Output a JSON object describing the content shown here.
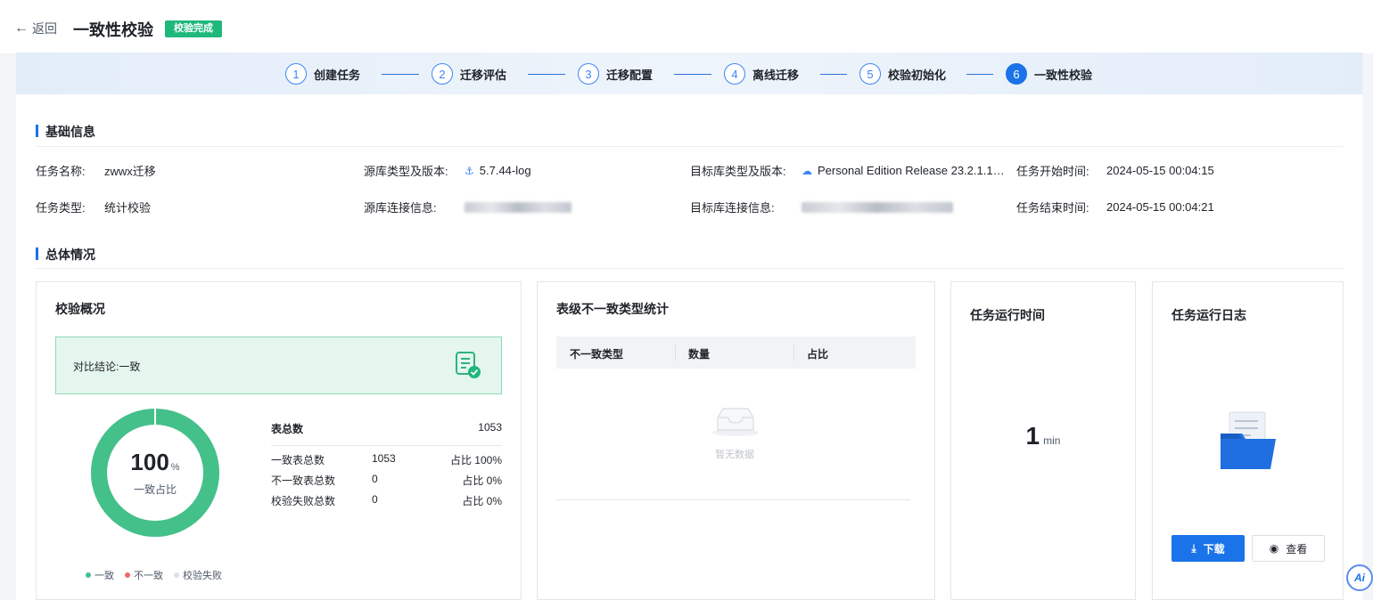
{
  "header": {
    "back_label": "返回",
    "title": "一致性校验",
    "status_badge": "校验完成"
  },
  "steps": [
    {
      "num": "1",
      "label": "创建任务"
    },
    {
      "num": "2",
      "label": "迁移评估"
    },
    {
      "num": "3",
      "label": "迁移配置"
    },
    {
      "num": "4",
      "label": "离线迁移"
    },
    {
      "num": "5",
      "label": "校验初始化"
    },
    {
      "num": "6",
      "label": "一致性校验",
      "active": true
    }
  ],
  "basic_info": {
    "section_title": "基础信息",
    "task_name_label": "任务名称:",
    "task_name": "zwwx迁移",
    "task_type_label": "任务类型:",
    "task_type": "统计校验",
    "source_type_label": "源库类型及版本:",
    "source_type": "5.7.44-log",
    "source_conn_label": "源库连接信息:",
    "target_type_label": "目标库类型及版本:",
    "target_type": "Personal Edition Release 23.2.1.1…",
    "target_conn_label": "目标库连接信息:",
    "start_time_label": "任务开始时间:",
    "start_time": "2024-05-15 00:04:15",
    "end_time_label": "任务结束时间:",
    "end_time": "2024-05-15 00:04:21"
  },
  "overview": {
    "section_title": "总体情况",
    "verify_card": {
      "title": "校验概况",
      "conclusion": "对比结论:一致",
      "consistent_percent": 100,
      "percent_value": "100",
      "percent_unit": "%",
      "percent_caption": "一致占比",
      "total_label": "表总数",
      "total_value": "1053",
      "rows": [
        {
          "label": "一致表总数",
          "count": "1053",
          "ratio": "占比 100%"
        },
        {
          "label": "不一致表总数",
          "count": "0",
          "ratio": "占比 0%"
        },
        {
          "label": "校验失败总数",
          "count": "0",
          "ratio": "占比 0%"
        }
      ],
      "legend": [
        {
          "label": "一致",
          "color": "#44c08a"
        },
        {
          "label": "不一致",
          "color": "#f06a6a"
        },
        {
          "label": "校验失败",
          "color": "#dcdfe4"
        }
      ]
    },
    "inconsistency_card": {
      "title": "表级不一致类型统计",
      "columns": [
        "不一致类型",
        "数量",
        "占比"
      ],
      "empty_text": "暂无数据"
    },
    "runtime_card": {
      "title": "任务运行时间",
      "value": "1",
      "unit": "min"
    },
    "log_card": {
      "title": "任务运行日志",
      "download_label": "下载",
      "view_label": "查看"
    }
  },
  "colors": {
    "accent": "#1a73e8",
    "success": "#1fb87c",
    "donut": "#44c08a"
  }
}
